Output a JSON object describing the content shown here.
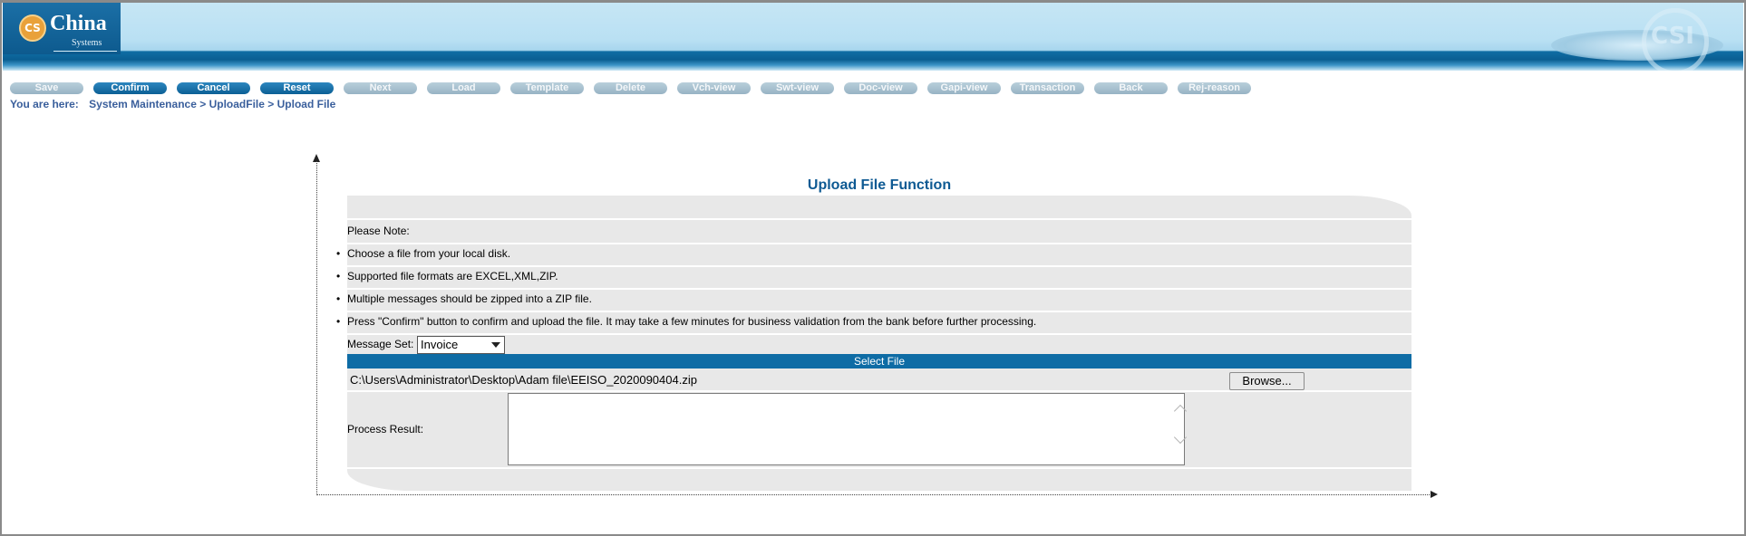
{
  "header": {
    "logo_mark": "CS",
    "brand": "China",
    "brand_sub": "Systems",
    "watermark": "CSI"
  },
  "toolbar": {
    "buttons": [
      {
        "label": "Save",
        "state": "disabled"
      },
      {
        "label": "Confirm",
        "state": "active"
      },
      {
        "label": "Cancel",
        "state": "active"
      },
      {
        "label": "Reset",
        "state": "active"
      },
      {
        "label": "Next",
        "state": "disabled"
      },
      {
        "label": "Load",
        "state": "disabled"
      },
      {
        "label": "Template",
        "state": "disabled"
      },
      {
        "label": "Delete",
        "state": "disabled"
      },
      {
        "label": "Vch-view",
        "state": "disabled"
      },
      {
        "label": "Swt-view",
        "state": "disabled"
      },
      {
        "label": "Doc-view",
        "state": "disabled"
      },
      {
        "label": "Gapi-view",
        "state": "disabled"
      },
      {
        "label": "Transaction",
        "state": "disabled"
      },
      {
        "label": "Back",
        "state": "disabled"
      },
      {
        "label": "Rej-reason",
        "state": "disabled"
      }
    ]
  },
  "breadcrumb": {
    "prefix": "You are here:",
    "items": [
      "System Maintenance",
      "UploadFile",
      "Upload File"
    ],
    "separator": ">"
  },
  "panel": {
    "title": "Upload File Function",
    "note_label": "Please Note:",
    "notes": [
      "Choose a file from your local disk.",
      "Supported file formats are EXCEL,XML,ZIP.",
      "Multiple messages should be zipped into a ZIP file.",
      "Press \"Confirm\" button to confirm and upload the file. It may take a few minutes for business validation from the bank before further processing."
    ],
    "message_set_label": "Message Set:",
    "message_set_value": "Invoice",
    "select_file_header": "Select File",
    "file_path": "C:\\Users\\Administrator\\Desktop\\Adam file\\EEISO_2020090404.zip",
    "browse_label": "Browse...",
    "process_result_label": "Process Result:",
    "process_result_value": ""
  },
  "colors": {
    "accent": "#0e6ca5",
    "title": "#0e5a93",
    "breadcrumb": "#3a5f9c",
    "panel_bg": "#e8e8e8",
    "button_active": "#0b5f95",
    "button_disabled": "#a9c2d1"
  }
}
